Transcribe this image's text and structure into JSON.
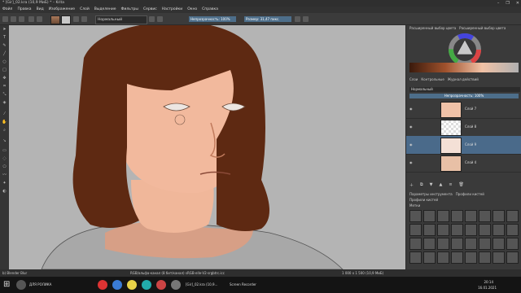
{
  "window": {
    "title": "* [Gir]_02.kra (10,9 MиБ) * – Krita",
    "controls": [
      "–",
      "❐",
      "✕"
    ]
  },
  "menu": [
    "Файл",
    "Правка",
    "Вид",
    "Изображение",
    "Слой",
    "Выделение",
    "Фильтры",
    "Сервис",
    "Настройки",
    "Окно",
    "Справка"
  ],
  "toolbar": {
    "blend_mode": "Нормальный",
    "opacity": "Непрозрачность: 100%",
    "size": "Размер: 31,47 пикс."
  },
  "dock": {
    "color_tabs": [
      "Расширенный выбор цвета",
      "Расширенный выбор цвета"
    ],
    "layers_tabs": [
      "Слои",
      "Контрольные",
      "Журнал действий"
    ],
    "layer_mode": "Нормальный",
    "layer_opacity": "Непрозрачность: 100%",
    "layers": [
      {
        "name": "Слой 7"
      },
      {
        "name": "Слой 8"
      },
      {
        "name": "Слой 9"
      },
      {
        "name": "Слой 4"
      }
    ],
    "brush_tabs": [
      "Параметры инструмента",
      "Профили кистей"
    ],
    "brush_presets_title": "Профили кистей",
    "tag_label": "Метки"
  },
  "status": {
    "brush": "b) Blender Blur",
    "color_info": "RGB/альфа-канал (8 бит/канал)  sRGB-elle-V2-srgbtrc.icc",
    "size_info": "1 000 x 1 500 (10,9 MиБ)"
  },
  "taskbar": {
    "items": [
      "ДЛЯ РОЛИКА",
      "[Gir]_02.kra (10,9...",
      "Screen Recorder"
    ],
    "time": "20:14",
    "date": "16.01.2021"
  }
}
